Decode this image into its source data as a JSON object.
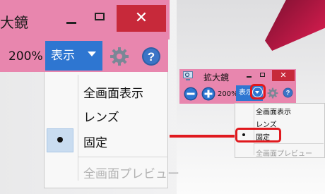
{
  "big_window": {
    "title": "大鏡",
    "close_glyph": "✕",
    "zoom_level": "200%",
    "display_button_label": "表示",
    "menu_items": [
      "全画面表示",
      "レンズ",
      "固定",
      "全画面プレビュー"
    ],
    "selected_item": "固定",
    "icons": [
      "minimize-icon",
      "maximize-icon",
      "close-icon",
      "chevron-down-icon",
      "gear-icon",
      "help-icon",
      "check-dot-icon"
    ]
  },
  "small_window": {
    "title": "拡大鏡",
    "close_glyph": "✕",
    "zoom_level": "200%",
    "display_button_label": "表示",
    "menu_items": [
      "全画面表示",
      "レンズ",
      "固定",
      "全画面プレビュー"
    ],
    "selected_item": "固定",
    "icons": [
      "magnifier-app-icon",
      "zoom-out-icon",
      "zoom-in-icon",
      "chevron-down-icon",
      "gear-icon",
      "help-icon"
    ]
  },
  "colors": {
    "titlebar_pink": "#e886ae",
    "close_red": "#c7293a",
    "accent_blue": "#2e76d1",
    "highlight_red": "#e0191e",
    "selected_bg": "#c9dcf0"
  }
}
